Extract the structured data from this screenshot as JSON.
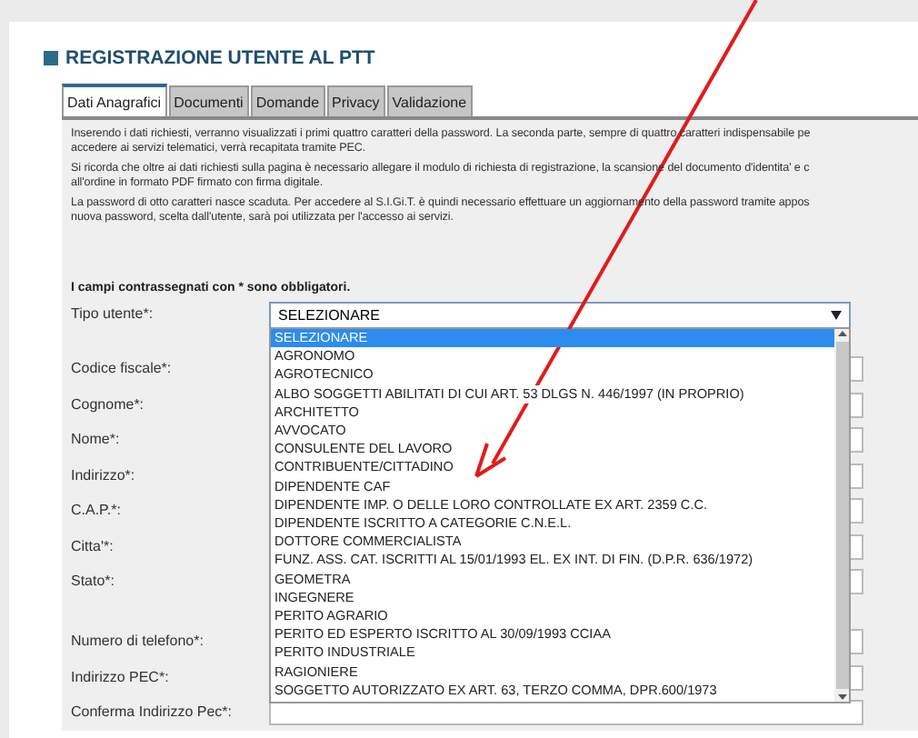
{
  "title": "REGISTRAZIONE UTENTE AL PTT",
  "tabs": [
    {
      "label": "Dati Anagrafici",
      "selected": true
    },
    {
      "label": "Documenti",
      "selected": false
    },
    {
      "label": "Domande",
      "selected": false
    },
    {
      "label": "Privacy",
      "selected": false
    },
    {
      "label": "Validazione",
      "selected": false
    }
  ],
  "paragraphs": [
    [
      "Inserendo i dati richiesti, verranno visualizzati i primi quattro caratteri della password. La seconda parte, sempre di quattro caratteri indispensabile pe",
      "accedere ai servizi telematici, verrà recapitata tramite PEC."
    ],
    [
      "Si ricorda che oltre ai dati richiesti sulla pagina è necessario allegare il modulo di richiesta di registrazione, la scansione del documento d'identita' e c",
      "all'ordine in formato PDF firmato con firma digitale."
    ],
    [
      "La password di otto caratteri nasce scaduta. Per accedere al S.I.Gi.T. è quindi necessario effettuare un aggiornamento della password tramite appos",
      "nuova password, scelta dall'utente, sarà poi utilizzata per l'accesso ai servizi."
    ]
  ],
  "required_note": "I campi contrassegnati con * sono obbligatori.",
  "fields": [
    {
      "label": "Tipo utente*:",
      "kind": "select",
      "value": "SELEZIONARE"
    },
    {
      "label": "Codice fiscale*:",
      "kind": "input"
    },
    {
      "label": "Cognome*:",
      "kind": "input"
    },
    {
      "label": "Nome*:",
      "kind": "input"
    },
    {
      "label": "Indirizzo*:",
      "kind": "input"
    },
    {
      "label": "C.A.P.*:",
      "kind": "input"
    },
    {
      "label": "Citta'*:",
      "kind": "input"
    },
    {
      "label": "Stato*:",
      "kind": "input"
    },
    {
      "label": "Numero di telefono*:",
      "kind": "input"
    },
    {
      "label": "Indirizzo PEC*:",
      "kind": "input"
    },
    {
      "label": "Conferma Indirizzo Pec*:",
      "kind": "input"
    }
  ],
  "dropdown_options": [
    {
      "label": "SELEZIONARE",
      "selected": true
    },
    {
      "label": "AGRONOMO",
      "selected": false
    },
    {
      "label": "AGROTECNICO",
      "selected": false
    },
    {
      "label": "ALBO SOGGETTI ABILITATI DI CUI ART. 53 DLGS N. 446/1997 (IN PROPRIO)",
      "selected": false
    },
    {
      "label": "ARCHITETTO",
      "selected": false
    },
    {
      "label": "AVVOCATO",
      "selected": false
    },
    {
      "label": "CONSULENTE DEL LAVORO",
      "selected": false
    },
    {
      "label": "CONTRIBUENTE/CITTADINO",
      "selected": false
    },
    {
      "label": "DIPENDENTE CAF",
      "selected": false
    },
    {
      "label": "DIPENDENTE IMP. O DELLE LORO CONTROLLATE EX ART. 2359 C.C.",
      "selected": false
    },
    {
      "label": "DIPENDENTE ISCRITTO A CATEGORIE C.N.E.L.",
      "selected": false
    },
    {
      "label": "DOTTORE COMMERCIALISTA",
      "selected": false
    },
    {
      "label": "FUNZ. ASS. CAT. ISCRITTI AL 15/01/1993 EL. EX INT. DI FIN. (D.P.R. 636/1972)",
      "selected": false
    },
    {
      "label": "GEOMETRA",
      "selected": false
    },
    {
      "label": "INGEGNERE",
      "selected": false
    },
    {
      "label": "PERITO AGRARIO",
      "selected": false
    },
    {
      "label": "PERITO ED ESPERTO ISCRITTO AL 30/09/1993 CCIAA",
      "selected": false
    },
    {
      "label": "PERITO INDUSTRIALE",
      "selected": false
    },
    {
      "label": "RAGIONIERE",
      "selected": false
    },
    {
      "label": "SOGGETTO AUTORIZZATO EX ART. 63, TERZO COMMA, DPR.600/1973",
      "selected": false
    }
  ]
}
